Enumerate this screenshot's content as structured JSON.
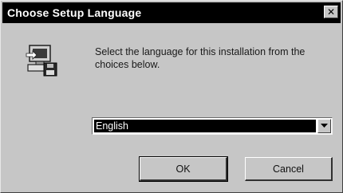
{
  "window": {
    "title": "Choose Setup Language",
    "close_glyph": "✕",
    "colors": {
      "titlebar": "#000000",
      "face": "#c6c6c6",
      "selection": "#000000"
    }
  },
  "dialog": {
    "icon": "computer-setup-icon",
    "prompt": "Select the language for this installation from the choices below."
  },
  "language_select": {
    "selected": "English",
    "arrow_icon": "dropdown-arrow-icon"
  },
  "buttons": {
    "ok_label": "OK",
    "cancel_label": "Cancel"
  }
}
